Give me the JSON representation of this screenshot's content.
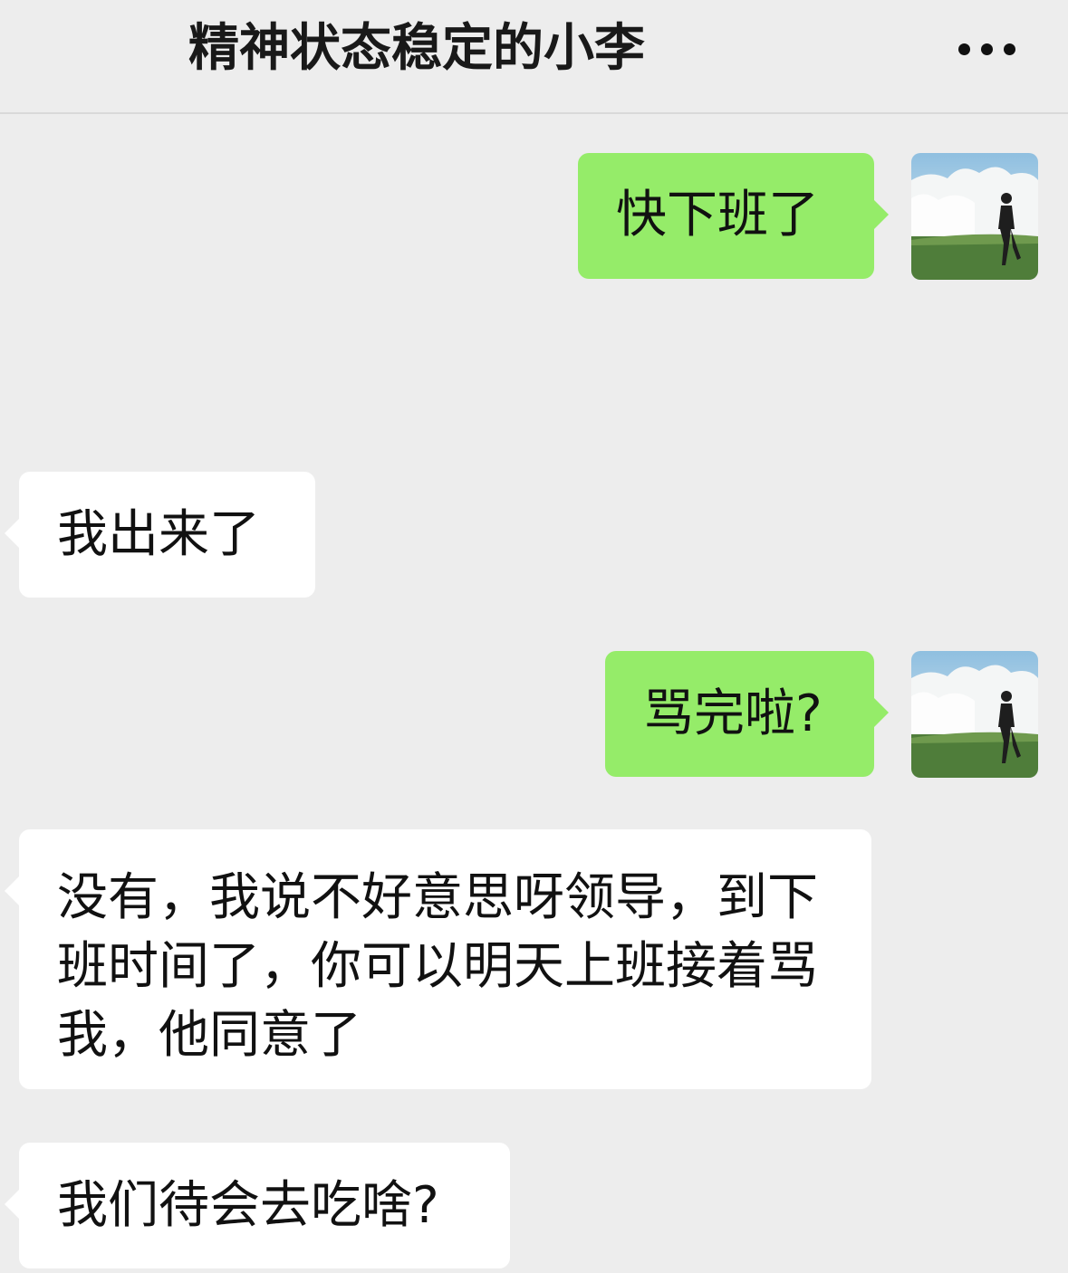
{
  "header": {
    "title": "精神状态稳定的小李",
    "more_icon": "ellipsis-icon"
  },
  "colors": {
    "background": "#ededed",
    "my_bubble": "#95ec69",
    "other_bubble": "#ffffff"
  },
  "messages": [
    {
      "sender": "me",
      "text": "快下班了"
    },
    {
      "sender": "other",
      "text": "我出来了"
    },
    {
      "sender": "me",
      "text": "骂完啦?"
    },
    {
      "sender": "other",
      "text": "没有，我说不好意思呀领导，到下班时间了，你可以明天上班接着骂我，他同意了"
    },
    {
      "sender": "other",
      "text": "我们待会去吃啥?"
    }
  ]
}
